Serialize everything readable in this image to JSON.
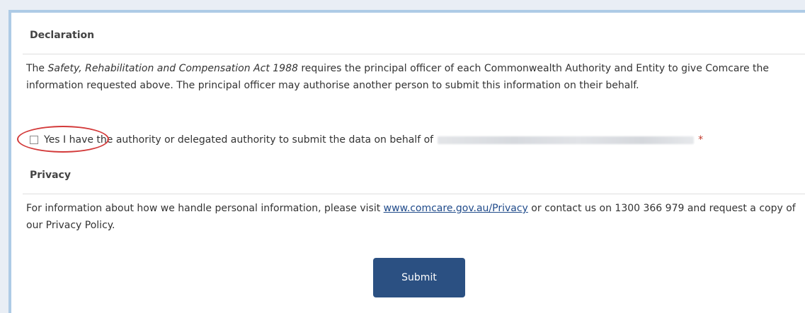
{
  "declaration": {
    "title": "Declaration",
    "text_prefix": "The ",
    "act_name": "Safety, Rehabilitation and Compensation Act 1988",
    "text_suffix": " requires the principal officer of each Commonwealth Authority and Entity to give Comcare the information requested above. The principal officer may authorise another person to submit this information on their behalf.",
    "checkbox": {
      "checked": false,
      "label": "Yes I have the authority or delegated authority to submit the data on behalf of",
      "required_marker": "*"
    }
  },
  "privacy": {
    "title": "Privacy",
    "text_prefix": "For information about how we handle personal information, please visit ",
    "link_text": "www.comcare.gov.au/Privacy",
    "text_suffix": " or contact us on 1300 366 979 and request a copy of our Privacy Policy."
  },
  "actions": {
    "submit_label": "Submit"
  },
  "colors": {
    "button_bg": "#2b5082",
    "annotation_circle": "#d33a3a",
    "link": "#1f4a8a",
    "frame_border": "#aecbe6"
  }
}
